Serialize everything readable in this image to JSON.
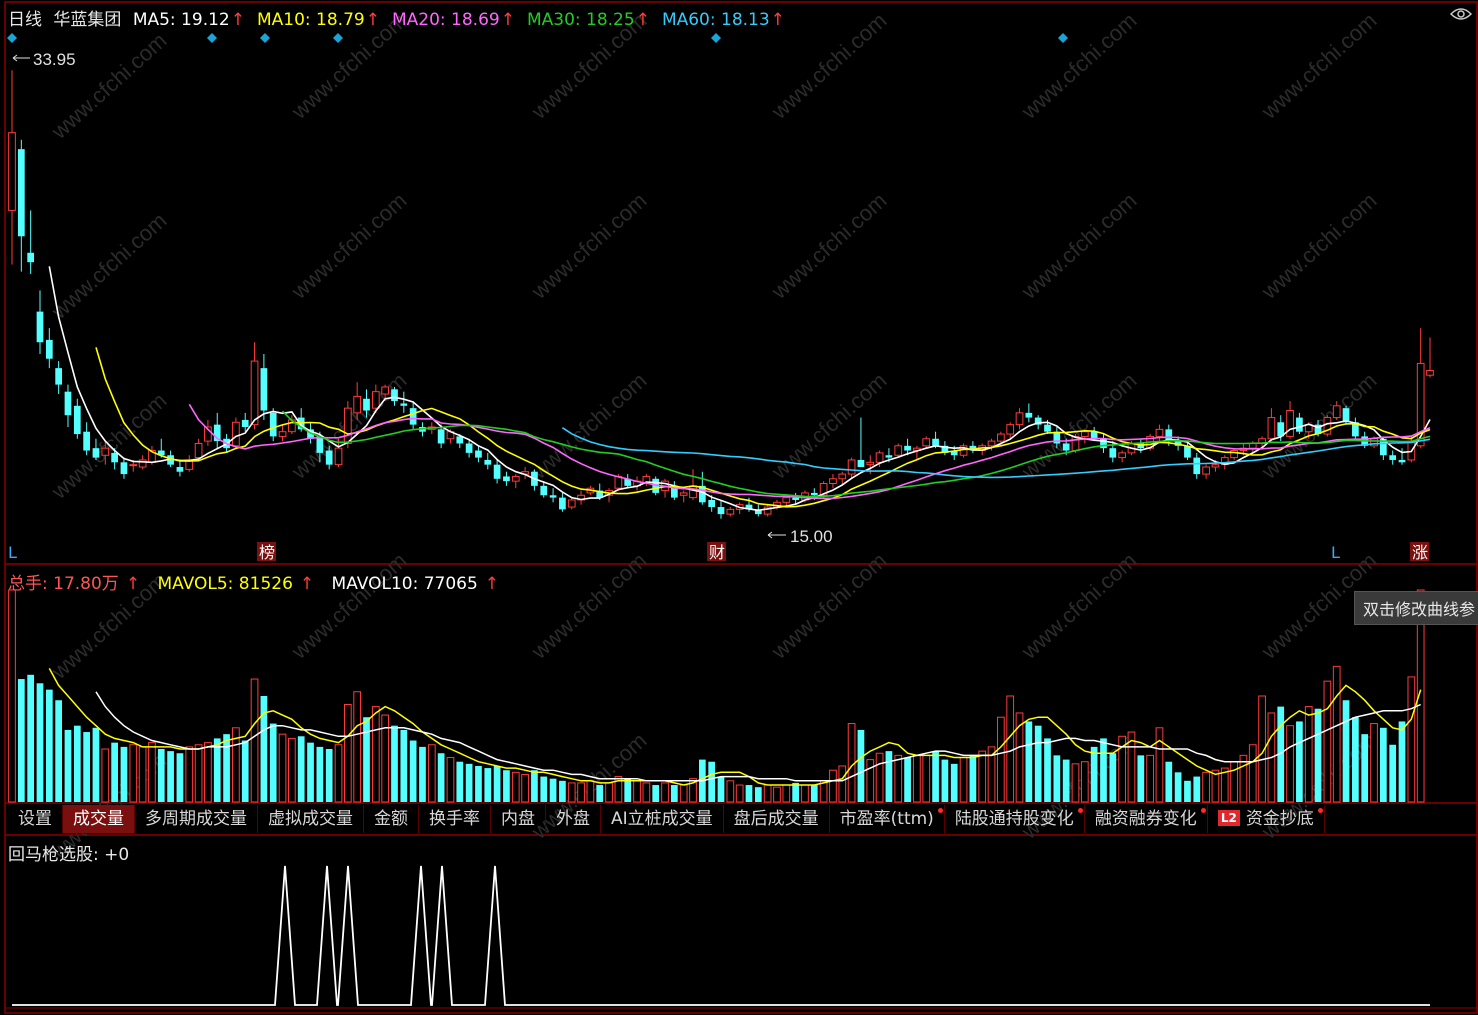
{
  "header": {
    "period": "日线",
    "stock_name": "华蓝集团",
    "ma": [
      {
        "label": "MA5: 19.12",
        "color": "#ffffff"
      },
      {
        "label": "MA10: 18.79",
        "color": "#ffff00"
      },
      {
        "label": "MA20: 18.69",
        "color": "#ff66ff"
      },
      {
        "label": "MA30: 18.25",
        "color": "#22cc22"
      },
      {
        "label": "MA60: 18.13",
        "color": "#33ccff"
      }
    ]
  },
  "price_chart": {
    "high_label": "33.95",
    "low_label": "15.00",
    "markers": [
      {
        "text": "L",
        "kind": "plain"
      },
      {
        "text": "榜",
        "kind": "boxed"
      },
      {
        "text": "财",
        "kind": "boxed"
      },
      {
        "text": "L",
        "kind": "plain"
      },
      {
        "text": "涨",
        "kind": "boxed"
      }
    ]
  },
  "volume_header": {
    "total": "总手: 17.80万",
    "mavol5": "MAVOL5: 81526",
    "mavol10": "MAVOL10: 77065"
  },
  "tooltip": "双击修改曲线参",
  "tabs": [
    {
      "label": "设置",
      "active": false,
      "dot": false
    },
    {
      "label": "成交量",
      "active": true,
      "dot": false
    },
    {
      "label": "多周期成交量",
      "active": false,
      "dot": false
    },
    {
      "label": "虚拟成交量",
      "active": false,
      "dot": false
    },
    {
      "label": "金额",
      "active": false,
      "dot": false
    },
    {
      "label": "换手率",
      "active": false,
      "dot": false
    },
    {
      "label": "内盘",
      "active": false,
      "dot": false
    },
    {
      "label": "外盘",
      "active": false,
      "dot": false
    },
    {
      "label": "AI立桩成交量",
      "active": false,
      "dot": false
    },
    {
      "label": "盘后成交量",
      "active": false,
      "dot": false
    },
    {
      "label": "市盈率(ttm)",
      "active": false,
      "dot": true
    },
    {
      "label": "陆股通持股变化",
      "active": false,
      "dot": true
    },
    {
      "label": "融资融券变化",
      "active": false,
      "dot": true
    },
    {
      "label": "资金抄底",
      "active": false,
      "dot": true,
      "badge": "L2"
    }
  ],
  "indicator": {
    "label": "回马枪选股: +0"
  },
  "watermark": "www.cfchi.com",
  "colors": {
    "up": "#ff3b3b",
    "down": "#54ffff",
    "border": "#8b0000",
    "marker": "#1aa5d6"
  },
  "chart_data": {
    "type": "candlestick",
    "price_range": [
      15.0,
      33.95
    ],
    "ohlc": [
      [
        28.0,
        33.95,
        25.7,
        31.3
      ],
      [
        30.6,
        31.0,
        25.4,
        26.9
      ],
      [
        26.2,
        28.0,
        25.3,
        25.8
      ],
      [
        23.7,
        24.6,
        21.9,
        22.4
      ],
      [
        22.5,
        23.0,
        21.3,
        21.7
      ],
      [
        21.3,
        21.6,
        20.2,
        20.6
      ],
      [
        20.3,
        20.6,
        18.8,
        19.3
      ],
      [
        19.7,
        20.0,
        18.3,
        18.5
      ],
      [
        18.6,
        19.0,
        17.6,
        17.8
      ],
      [
        17.9,
        18.3,
        17.4,
        17.5
      ],
      [
        17.6,
        18.2,
        17.2,
        17.9
      ],
      [
        17.7,
        17.9,
        17.0,
        17.3
      ],
      [
        17.3,
        17.5,
        16.6,
        16.8
      ],
      [
        17.2,
        17.4,
        16.9,
        17.2
      ],
      [
        17.1,
        17.6,
        17.0,
        17.4
      ],
      [
        17.3,
        18.0,
        17.2,
        17.8
      ],
      [
        17.8,
        18.3,
        17.5,
        17.6
      ],
      [
        17.6,
        17.8,
        17.1,
        17.2
      ],
      [
        17.1,
        17.4,
        16.7,
        16.9
      ],
      [
        17.0,
        17.6,
        16.9,
        17.4
      ],
      [
        17.5,
        18.3,
        17.4,
        18.1
      ],
      [
        18.2,
        19.1,
        18.0,
        18.8
      ],
      [
        18.9,
        19.4,
        17.9,
        18.2
      ],
      [
        18.3,
        18.5,
        17.7,
        17.9
      ],
      [
        18.0,
        19.2,
        17.9,
        19.0
      ],
      [
        19.1,
        19.4,
        18.6,
        18.8
      ],
      [
        18.9,
        22.4,
        18.7,
        21.6
      ],
      [
        21.3,
        21.9,
        19.1,
        19.5
      ],
      [
        19.4,
        19.6,
        18.2,
        18.4
      ],
      [
        18.4,
        18.9,
        18.2,
        18.6
      ],
      [
        18.6,
        19.3,
        18.5,
        19.1
      ],
      [
        19.2,
        19.6,
        18.6,
        18.7
      ],
      [
        18.7,
        19.0,
        18.1,
        18.3
      ],
      [
        18.4,
        18.6,
        17.3,
        17.7
      ],
      [
        17.8,
        18.0,
        17.0,
        17.2
      ],
      [
        17.2,
        18.3,
        17.1,
        17.9
      ],
      [
        18.1,
        19.9,
        17.9,
        19.6
      ],
      [
        19.4,
        20.7,
        19.1,
        20.1
      ],
      [
        20.0,
        20.4,
        19.2,
        19.5
      ],
      [
        19.6,
        20.6,
        19.4,
        20.3
      ],
      [
        20.2,
        20.6,
        19.9,
        20.5
      ],
      [
        20.4,
        20.5,
        19.7,
        19.9
      ],
      [
        19.8,
        20.3,
        19.4,
        19.7
      ],
      [
        19.6,
        19.9,
        18.7,
        18.9
      ],
      [
        18.8,
        19.0,
        18.4,
        18.6
      ],
      [
        18.7,
        19.0,
        18.5,
        18.8
      ],
      [
        18.7,
        18.9,
        17.9,
        18.1
      ],
      [
        18.3,
        18.7,
        18.1,
        18.6
      ],
      [
        18.4,
        18.5,
        17.9,
        18.1
      ],
      [
        18.1,
        18.3,
        17.5,
        17.7
      ],
      [
        17.8,
        18.0,
        17.3,
        17.5
      ],
      [
        17.4,
        17.7,
        17.0,
        17.2
      ],
      [
        17.2,
        17.4,
        16.4,
        16.6
      ],
      [
        16.7,
        16.9,
        16.3,
        16.5
      ],
      [
        16.5,
        16.8,
        16.2,
        16.7
      ],
      [
        16.8,
        17.1,
        16.6,
        16.9
      ],
      [
        16.9,
        17.0,
        16.1,
        16.3
      ],
      [
        16.3,
        16.5,
        15.8,
        15.9
      ],
      [
        15.9,
        16.2,
        15.6,
        15.8
      ],
      [
        15.8,
        16.0,
        15.2,
        15.3
      ],
      [
        15.4,
        15.8,
        15.3,
        15.7
      ],
      [
        15.7,
        16.1,
        15.5,
        15.9
      ],
      [
        16.0,
        16.3,
        15.9,
        16.2
      ],
      [
        16.1,
        16.4,
        15.7,
        15.8
      ],
      [
        15.9,
        16.2,
        15.6,
        16.1
      ],
      [
        16.2,
        16.8,
        16.1,
        16.7
      ],
      [
        16.6,
        16.8,
        16.2,
        16.3
      ],
      [
        16.3,
        16.7,
        16.1,
        16.5
      ],
      [
        16.4,
        16.8,
        16.3,
        16.7
      ],
      [
        16.6,
        16.7,
        15.9,
        16.0
      ],
      [
        16.1,
        16.6,
        15.8,
        16.5
      ],
      [
        16.3,
        16.5,
        15.7,
        15.8
      ],
      [
        15.9,
        16.1,
        15.6,
        16.0
      ],
      [
        15.8,
        17.0,
        15.7,
        16.3
      ],
      [
        16.3,
        16.9,
        15.5,
        15.6
      ],
      [
        15.7,
        15.9,
        15.2,
        15.4
      ],
      [
        15.4,
        15.7,
        14.9,
        15.1
      ],
      [
        15.1,
        15.4,
        15.0,
        15.3
      ],
      [
        15.3,
        15.6,
        15.1,
        15.5
      ],
      [
        15.5,
        15.8,
        15.2,
        15.3
      ],
      [
        15.3,
        15.5,
        15.0,
        15.1
      ],
      [
        15.1,
        15.5,
        15.0,
        15.4
      ],
      [
        15.4,
        15.7,
        15.3,
        15.6
      ],
      [
        15.6,
        15.9,
        15.4,
        15.8
      ],
      [
        15.8,
        16.0,
        15.5,
        15.7
      ],
      [
        15.7,
        16.1,
        15.6,
        16.0
      ],
      [
        16.0,
        16.2,
        15.7,
        15.9
      ],
      [
        15.9,
        16.5,
        15.8,
        16.4
      ],
      [
        16.4,
        16.8,
        16.2,
        16.6
      ],
      [
        16.6,
        16.9,
        16.3,
        16.8
      ],
      [
        16.8,
        17.5,
        16.6,
        17.4
      ],
      [
        17.4,
        19.2,
        17.2,
        17.1
      ],
      [
        17.2,
        17.6,
        16.8,
        17.3
      ],
      [
        17.3,
        17.8,
        17.1,
        17.7
      ],
      [
        17.6,
        17.9,
        17.3,
        17.5
      ],
      [
        17.6,
        18.1,
        17.5,
        18.0
      ],
      [
        18.0,
        18.3,
        17.6,
        17.8
      ],
      [
        17.8,
        18.0,
        17.4,
        17.9
      ],
      [
        18.0,
        18.4,
        17.9,
        18.3
      ],
      [
        18.3,
        18.6,
        17.9,
        18.0
      ],
      [
        18.0,
        18.2,
        17.6,
        17.7
      ],
      [
        17.8,
        18.0,
        17.4,
        17.6
      ],
      [
        17.6,
        18.1,
        17.5,
        18.0
      ],
      [
        18.0,
        18.2,
        17.7,
        17.8
      ],
      [
        17.8,
        18.1,
        17.6,
        18.0
      ],
      [
        18.0,
        18.3,
        17.8,
        18.2
      ],
      [
        18.2,
        18.6,
        18.0,
        18.5
      ],
      [
        18.5,
        19.0,
        18.3,
        18.9
      ],
      [
        18.9,
        19.6,
        18.7,
        19.4
      ],
      [
        19.4,
        19.8,
        19.0,
        19.2
      ],
      [
        19.2,
        19.3,
        18.7,
        18.9
      ],
      [
        18.9,
        19.1,
        18.5,
        18.6
      ],
      [
        18.6,
        18.8,
        17.9,
        18.1
      ],
      [
        18.1,
        18.3,
        17.6,
        17.8
      ],
      [
        17.8,
        18.5,
        17.7,
        18.4
      ],
      [
        18.4,
        18.7,
        18.1,
        18.6
      ],
      [
        18.6,
        18.8,
        18.2,
        18.3
      ],
      [
        18.3,
        18.5,
        17.7,
        17.9
      ],
      [
        17.9,
        18.2,
        17.3,
        17.5
      ],
      [
        17.5,
        17.8,
        17.3,
        17.7
      ],
      [
        17.7,
        18.2,
        17.6,
        18.1
      ],
      [
        18.1,
        18.3,
        17.7,
        17.9
      ],
      [
        17.9,
        18.5,
        17.8,
        18.4
      ],
      [
        18.4,
        18.9,
        18.2,
        18.7
      ],
      [
        18.7,
        18.9,
        18.0,
        18.2
      ],
      [
        18.2,
        18.4,
        17.8,
        18.0
      ],
      [
        18.0,
        18.2,
        17.4,
        17.5
      ],
      [
        17.5,
        17.7,
        16.6,
        16.8
      ],
      [
        16.8,
        17.2,
        16.6,
        17.1
      ],
      [
        17.1,
        17.4,
        16.9,
        17.2
      ],
      [
        17.2,
        17.6,
        17.0,
        17.5
      ],
      [
        17.5,
        17.9,
        17.4,
        17.8
      ],
      [
        17.8,
        18.1,
        17.6,
        17.9
      ],
      [
        17.9,
        18.2,
        17.7,
        18.1
      ],
      [
        18.1,
        18.4,
        17.9,
        18.3
      ],
      [
        18.3,
        19.6,
        18.2,
        19.2
      ],
      [
        19.0,
        19.3,
        18.2,
        18.4
      ],
      [
        18.4,
        19.9,
        18.3,
        19.5
      ],
      [
        19.2,
        19.4,
        18.5,
        18.6
      ],
      [
        18.6,
        19.0,
        18.3,
        18.9
      ],
      [
        18.9,
        19.1,
        18.4,
        18.5
      ],
      [
        18.5,
        19.3,
        18.4,
        19.2
      ],
      [
        19.2,
        19.9,
        19.1,
        19.7
      ],
      [
        19.6,
        19.7,
        18.9,
        19.0
      ],
      [
        19.0,
        19.2,
        18.3,
        18.4
      ],
      [
        18.4,
        18.6,
        17.9,
        18.0
      ],
      [
        18.0,
        18.4,
        17.9,
        18.3
      ],
      [
        18.3,
        18.4,
        17.4,
        17.6
      ],
      [
        17.6,
        17.8,
        17.2,
        17.4
      ],
      [
        17.4,
        17.9,
        17.2,
        17.3
      ],
      [
        17.4,
        18.4,
        17.3,
        18.2
      ],
      [
        18.0,
        23.0,
        17.9,
        21.5
      ],
      [
        21.0,
        22.6,
        20.9,
        21.2
      ]
    ],
    "volume_scale": "relative",
    "volume": [
      100,
      58,
      60,
      56,
      53,
      48,
      34,
      36,
      33,
      35,
      25,
      28,
      26,
      27,
      26,
      28,
      25,
      24,
      23,
      26,
      27,
      28,
      30,
      32,
      35,
      29,
      58,
      50,
      37,
      32,
      30,
      31,
      28,
      26,
      25,
      27,
      46,
      52,
      40,
      45,
      41,
      36,
      34,
      29,
      26,
      27,
      23,
      21,
      19,
      18,
      17,
      16,
      17,
      15,
      14,
      13,
      15,
      12,
      11,
      10,
      9,
      9,
      10,
      8,
      9,
      12,
      11,
      10,
      9,
      8,
      9,
      8,
      8,
      11,
      20,
      19,
      12,
      10,
      8,
      8,
      7,
      8,
      7,
      8,
      9,
      8,
      8,
      10,
      15,
      17,
      37,
      34,
      20,
      23,
      24,
      22,
      21,
      22,
      22,
      24,
      20,
      18,
      21,
      22,
      24,
      26,
      40,
      50,
      42,
      38,
      36,
      30,
      22,
      20,
      18,
      19,
      26,
      30,
      23,
      31,
      33,
      22,
      22,
      35,
      19,
      14,
      10,
      12,
      14,
      15,
      16,
      19,
      22,
      27,
      50,
      42,
      45,
      36,
      38,
      45,
      44,
      57,
      64,
      48,
      40,
      32,
      37,
      35,
      27,
      38,
      59,
      100
    ],
    "mavol5": [
      null,
      null,
      null,
      null,
      63,
      55,
      50,
      45,
      40,
      36,
      32,
      30,
      29,
      28,
      26,
      26,
      26,
      26,
      25,
      25,
      25,
      26,
      27,
      29,
      30,
      31,
      37,
      42,
      43,
      41,
      39,
      35,
      32,
      30,
      29,
      28,
      31,
      36,
      38,
      42,
      45,
      43,
      40,
      37,
      33,
      30,
      27,
      25,
      23,
      21,
      19,
      18,
      17,
      16,
      16,
      15,
      14,
      14,
      13,
      12,
      11,
      10,
      10,
      9,
      9,
      10,
      10,
      10,
      10,
      10,
      10,
      9,
      8,
      9,
      11,
      13,
      14,
      14,
      14,
      12,
      9,
      8,
      8,
      8,
      8,
      8,
      8,
      9,
      10,
      11,
      17,
      21,
      24,
      26,
      28,
      27,
      23,
      22,
      22,
      22,
      22,
      21,
      21,
      21,
      22,
      22,
      26,
      31,
      36,
      39,
      40,
      40,
      36,
      32,
      27,
      24,
      23,
      23,
      23,
      26,
      29,
      28,
      26,
      29,
      26,
      23,
      20,
      17,
      15,
      13,
      14,
      15,
      17,
      19,
      23,
      31,
      36,
      40,
      43,
      41,
      42,
      44,
      50,
      55,
      52,
      48,
      43,
      39,
      35,
      34,
      39,
      53
    ],
    "mavol10": [
      null,
      null,
      null,
      null,
      null,
      null,
      null,
      null,
      null,
      52,
      45,
      40,
      36,
      33,
      31,
      29,
      28,
      27,
      26,
      25,
      25,
      26,
      26,
      26,
      27,
      28,
      31,
      34,
      36,
      36,
      35,
      34,
      34,
      33,
      32,
      31,
      31,
      32,
      33,
      34,
      35,
      35,
      35,
      34,
      33,
      32,
      30,
      29,
      28,
      26,
      24,
      22,
      20,
      19,
      18,
      17,
      16,
      15,
      15,
      14,
      13,
      13,
      12,
      11,
      11,
      11,
      11,
      11,
      10,
      10,
      10,
      10,
      10,
      10,
      10,
      11,
      12,
      12,
      12,
      12,
      11,
      11,
      11,
      11,
      10,
      10,
      10,
      10,
      10,
      10,
      12,
      14,
      16,
      18,
      19,
      20,
      21,
      22,
      23,
      24,
      24,
      23,
      22,
      22,
      22,
      22,
      23,
      24,
      26,
      27,
      28,
      28,
      29,
      30,
      30,
      29,
      29,
      28,
      27,
      26,
      26,
      26,
      26,
      25,
      25,
      25,
      25,
      23,
      22,
      20,
      19,
      19,
      19,
      19,
      20,
      21,
      23,
      26,
      28,
      30,
      32,
      34,
      36,
      38,
      40,
      41,
      42,
      43,
      43,
      43,
      44,
      46
    ]
  }
}
